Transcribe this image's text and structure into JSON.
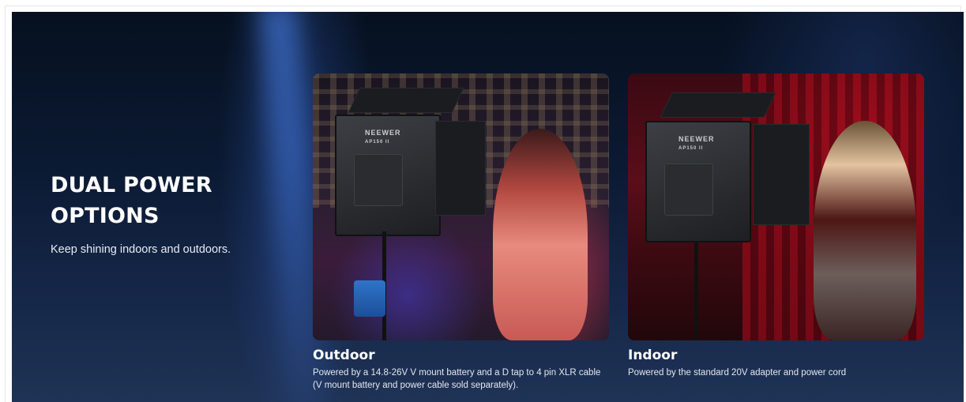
{
  "hero": {
    "title": "DUAL POWER OPTIONS",
    "subtitle": "Keep shining indoors and outdoors."
  },
  "cards": [
    {
      "title": "Outdoor",
      "description_lines": [
        "Powered by a 14.8-26V V mount battery and a D tap to 4 pin XLR cable",
        "(V mount battery and power cable sold separately)."
      ],
      "brand": "NEEWER",
      "model": "AP150 II"
    },
    {
      "title": "Indoor",
      "description_lines": [
        "Powered by the standard 20V adapter and power cord"
      ],
      "brand": "NEEWER",
      "model": "AP150 II"
    }
  ],
  "colors": {
    "background_top": "#06101f",
    "background_bottom": "#1f3356",
    "text_primary": "#ffffff",
    "accent_blue": "#2f74c9",
    "accent_red": "#b3142a"
  }
}
